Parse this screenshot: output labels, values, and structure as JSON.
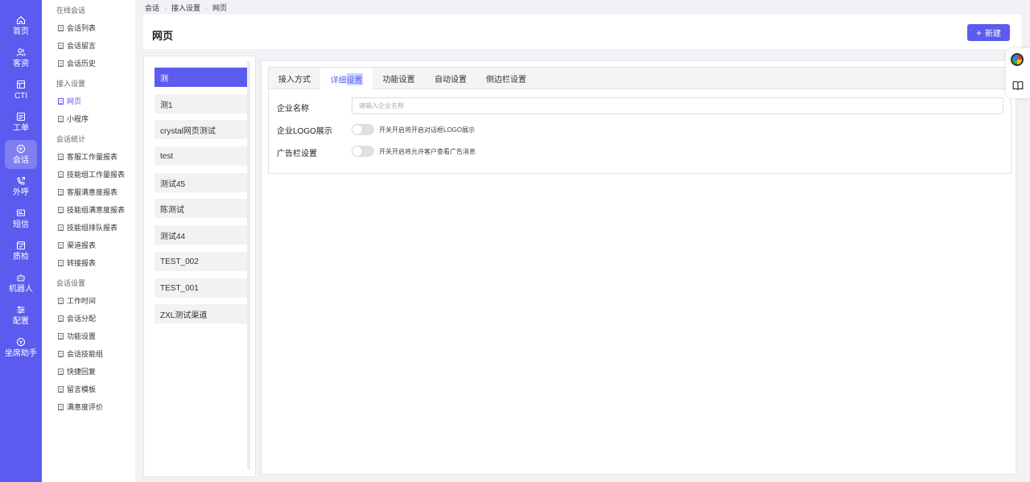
{
  "nav_rail": [
    {
      "label": "首页",
      "icon": "home-icon"
    },
    {
      "label": "客资",
      "icon": "customers-icon"
    },
    {
      "label": "CTI",
      "icon": "cti-icon"
    },
    {
      "label": "工单",
      "icon": "ticket-icon"
    },
    {
      "label": "会话",
      "icon": "chat-icon",
      "active": true
    },
    {
      "label": "外呼",
      "icon": "outbound-call-icon"
    },
    {
      "label": "短信",
      "icon": "sms-icon"
    },
    {
      "label": "质检",
      "icon": "quality-check-icon"
    },
    {
      "label": "机器人",
      "icon": "robot-icon"
    },
    {
      "label": "配置",
      "icon": "config-icon"
    },
    {
      "label": "坐席助手",
      "icon": "agent-assistant-icon"
    }
  ],
  "submenu": {
    "groups": [
      {
        "title": "在线会话",
        "items": [
          "会话列表",
          "会话留言",
          "会话历史"
        ]
      },
      {
        "title": "接入设置",
        "items": [
          "网页",
          "小程序"
        ]
      },
      {
        "title": "会话统计",
        "items": [
          "客服工作量报表",
          "技能组工作量报表",
          "客服满意度报表",
          "技能组满意度报表",
          "技能组排队报表",
          "渠道报表",
          "转接报表"
        ]
      },
      {
        "title": "会话设置",
        "items": [
          "工作时间",
          "会话分配",
          "功能设置",
          "会话技能组",
          "快捷回复",
          "留言模板",
          "满意度评价"
        ]
      }
    ],
    "active_item": "网页"
  },
  "breadcrumb": [
    "会话",
    "接入设置",
    "网页"
  ],
  "page": {
    "title": "网页",
    "new_button": "新建"
  },
  "channels": [
    "测",
    "测1",
    "crystal网页测试",
    "test",
    "测试45",
    "陈测试",
    "测试44",
    "TEST_002",
    "TEST_001",
    "ZXL测试渠道"
  ],
  "active_channel": "测",
  "tabs": [
    {
      "label": "接入方式"
    },
    {
      "label_plain": "详细",
      "label_highlight": "设置",
      "active": true
    },
    {
      "label": "功能设置"
    },
    {
      "label": "自动设置"
    },
    {
      "label": "侧边栏设置"
    }
  ],
  "form": {
    "company_name_label": "企业名称",
    "company_name_placeholder": "请输入企业名称",
    "company_name_value": "",
    "logo_label": "企业LOGO展示",
    "logo_hint": "开关开启将开启对话框LOGO展示",
    "logo_enabled": false,
    "ad_label": "广告栏设置",
    "ad_hint": "开关开启将允许客户查看广告消息",
    "ad_enabled": false
  },
  "colors": {
    "primary": "#5b5bf0",
    "rail_bg": "#5b5bf0",
    "page_bg": "#f0f2f5"
  }
}
